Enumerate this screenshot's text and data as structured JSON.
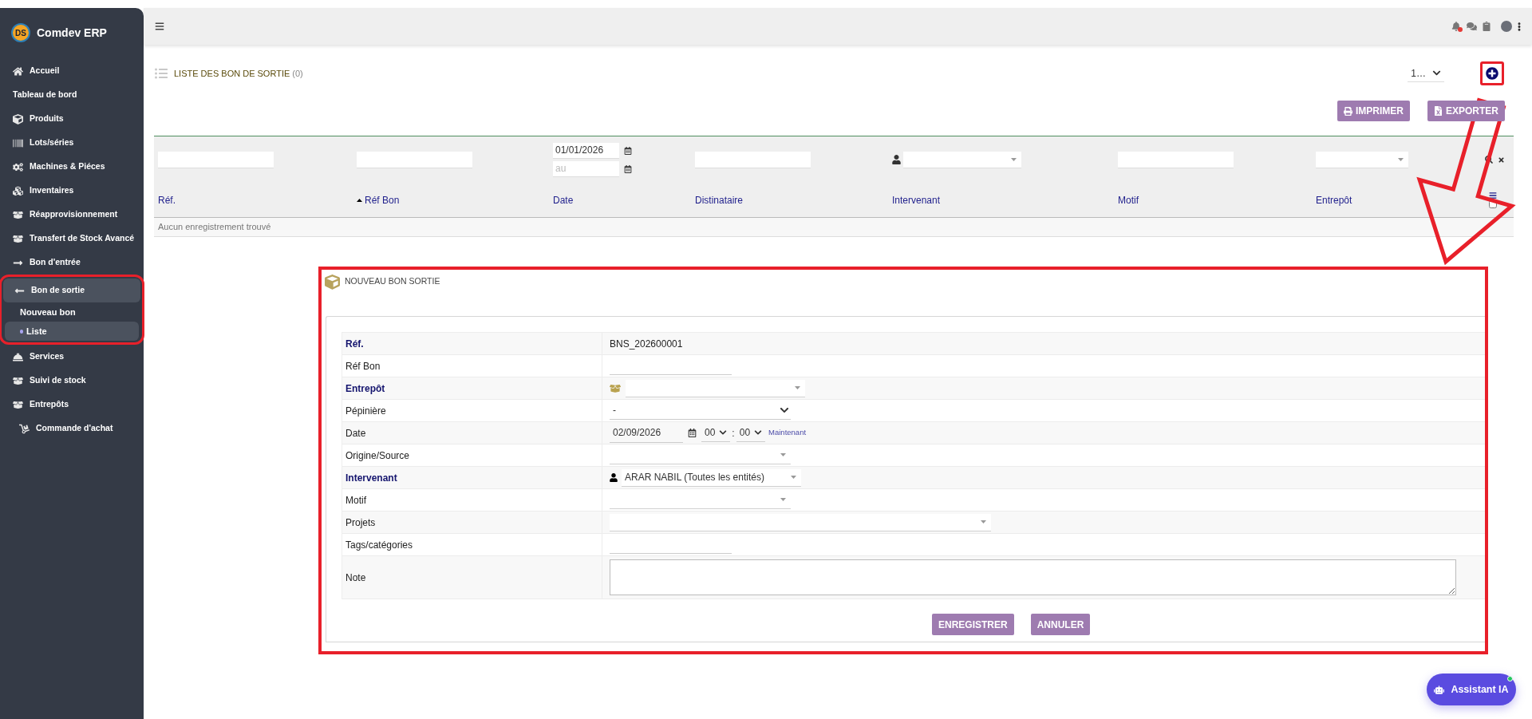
{
  "app": {
    "name": "Comdev ERP",
    "logo": "DS"
  },
  "sidebar": {
    "items": [
      {
        "label": "Accueil",
        "selected": false,
        "highlighted": false
      },
      {
        "label": "Tableau de bord",
        "selected": false,
        "highlighted": false
      },
      {
        "label": "Produits",
        "selected": false,
        "highlighted": false
      },
      {
        "label": "Lots/séries",
        "selected": false,
        "highlighted": false
      },
      {
        "label": "Machines & Piéces",
        "selected": false,
        "highlighted": false
      },
      {
        "label": "Inventaires",
        "selected": false,
        "highlighted": false
      },
      {
        "label": "Réapprovisionnement",
        "selected": false,
        "highlighted": false
      },
      {
        "label": "Transfert de Stock Avancé",
        "selected": false,
        "highlighted": false
      },
      {
        "label": "Bon d'entrée",
        "selected": false,
        "highlighted": false
      },
      {
        "label": "Bon de sortie",
        "selected": true,
        "highlighted": true,
        "expanded": true,
        "children": [
          {
            "label": "Nouveau bon",
            "selected": false
          },
          {
            "label": "Liste",
            "selected": true
          }
        ]
      },
      {
        "label": "Services",
        "selected": false,
        "highlighted": false
      },
      {
        "label": "Suivi de stock",
        "selected": false,
        "highlighted": false
      },
      {
        "label": "Entrepôts",
        "selected": false,
        "highlighted": false
      },
      {
        "label": "Commande d'achat",
        "selected": false,
        "highlighted": false
      }
    ]
  },
  "topbar": {
    "unread_notifications": true
  },
  "list": {
    "title": "LISTE DES BON DE SORTIE",
    "count": "(0)",
    "page_size": "1…",
    "add_highlighted": true,
    "buttons": [
      {
        "label": "IMPRIMER",
        "kind": "print"
      },
      {
        "label": "EXPORTER",
        "kind": "export"
      }
    ],
    "filters": [
      {
        "kind": "text"
      },
      {
        "kind": "text"
      },
      {
        "kind": "date_range",
        "value": "01/01/2026",
        "placeholder": "au"
      },
      {
        "kind": "text"
      },
      {
        "kind": "person_select"
      },
      {
        "kind": "text"
      },
      {
        "kind": "select"
      }
    ],
    "columns": [
      {
        "label": "Réf.",
        "sorted": false
      },
      {
        "label": "Réf Bon",
        "sorted": true
      },
      {
        "label": "Date",
        "sorted": false
      },
      {
        "label": "Distinataire",
        "sorted": false
      },
      {
        "label": "Intervenant",
        "sorted": false
      },
      {
        "label": "Motif",
        "sorted": false
      },
      {
        "label": "Entrepôt",
        "sorted": false
      }
    ],
    "select_all": {
      "checked": false
    },
    "empty_message": "Aucun enregistrement trouvé"
  },
  "form": {
    "title": "NOUVEAU BON SORTIE",
    "highlighted": true,
    "rows": [
      {
        "label": "Réf.",
        "required": true,
        "kind": "text",
        "value": "BNS_202600001"
      },
      {
        "label": "Réf Bon",
        "required": false,
        "kind": "input"
      },
      {
        "label": "Entrepôt",
        "required": true,
        "kind": "warehouse_select"
      },
      {
        "label": "Pépinière",
        "required": false,
        "kind": "dropdown",
        "value": "-"
      },
      {
        "label": "Date",
        "required": false,
        "kind": "datetime",
        "value": "02/09/2026",
        "hour": "00",
        "separator": ":",
        "minute": "00",
        "link": "Maintenant"
      },
      {
        "label": "Origine/Source",
        "required": false,
        "kind": "select"
      },
      {
        "label": "Intervenant",
        "required": true,
        "kind": "person_select",
        "value": "ARAR NABIL (Toutes les entités)"
      },
      {
        "label": "Motif",
        "required": false,
        "kind": "select"
      },
      {
        "label": "Projets",
        "required": false,
        "kind": "wide_select"
      },
      {
        "label": "Tags/catégories",
        "required": false,
        "kind": "input"
      },
      {
        "label": "Note",
        "required": false,
        "kind": "textarea"
      }
    ],
    "buttons": [
      "ENREGISTRER",
      "ANNULER"
    ]
  },
  "assistant": {
    "label": "Assistant IA",
    "online": true
  }
}
